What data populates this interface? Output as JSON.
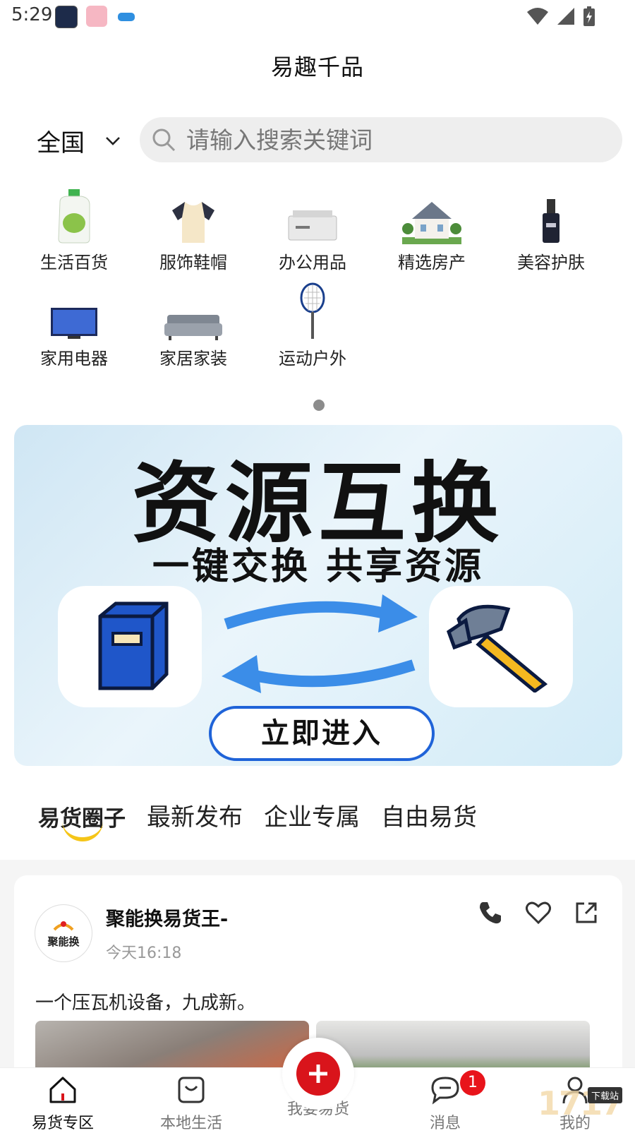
{
  "status_bar": {
    "time": "5:29"
  },
  "header": {
    "title": "易趣千品"
  },
  "search": {
    "region": "全国",
    "placeholder": "请输入搜索关键词"
  },
  "categories": [
    {
      "label": "生活百货",
      "icon": "detergent-bottle-icon"
    },
    {
      "label": "服饰鞋帽",
      "icon": "tshirt-icon"
    },
    {
      "label": "办公用品",
      "icon": "printer-icon"
    },
    {
      "label": "精选房产",
      "icon": "house-icon"
    },
    {
      "label": "美容护肤",
      "icon": "serum-bottle-icon"
    },
    {
      "label": "家用电器",
      "icon": "tv-icon"
    },
    {
      "label": "家居家装",
      "icon": "sofa-icon"
    },
    {
      "label": "运动户外",
      "icon": "tennis-racket-icon"
    }
  ],
  "banner": {
    "title": "资源互换",
    "subtitle": "一键交换 共享资源",
    "cta": "立即进入"
  },
  "tabs": [
    {
      "label": "易货圈子",
      "active": true
    },
    {
      "label": "最新发布",
      "active": false
    },
    {
      "label": "企业专属",
      "active": false
    },
    {
      "label": "自由易货",
      "active": false
    }
  ],
  "post": {
    "author": "聚能换易货王-",
    "avatar_text": "聚能换",
    "time": "今天16:18",
    "text": "一个压瓦机设备，九成新。"
  },
  "bottom_nav": [
    {
      "label": "易货专区",
      "icon": "home-icon",
      "active": true
    },
    {
      "label": "本地生活",
      "icon": "bag-icon",
      "active": false
    },
    {
      "label": "我要易货",
      "icon": "plus-icon",
      "active": false
    },
    {
      "label": "消息",
      "icon": "chat-icon",
      "active": false,
      "badge": "1"
    },
    {
      "label": "我的",
      "icon": "user-icon",
      "active": false
    }
  ],
  "watermark": {
    "text": "1717",
    "badge": "下载站"
  },
  "colors": {
    "accent_red": "#d9141b",
    "tab_underline": "#f5c518",
    "banner_blue": "#1f63d8"
  }
}
